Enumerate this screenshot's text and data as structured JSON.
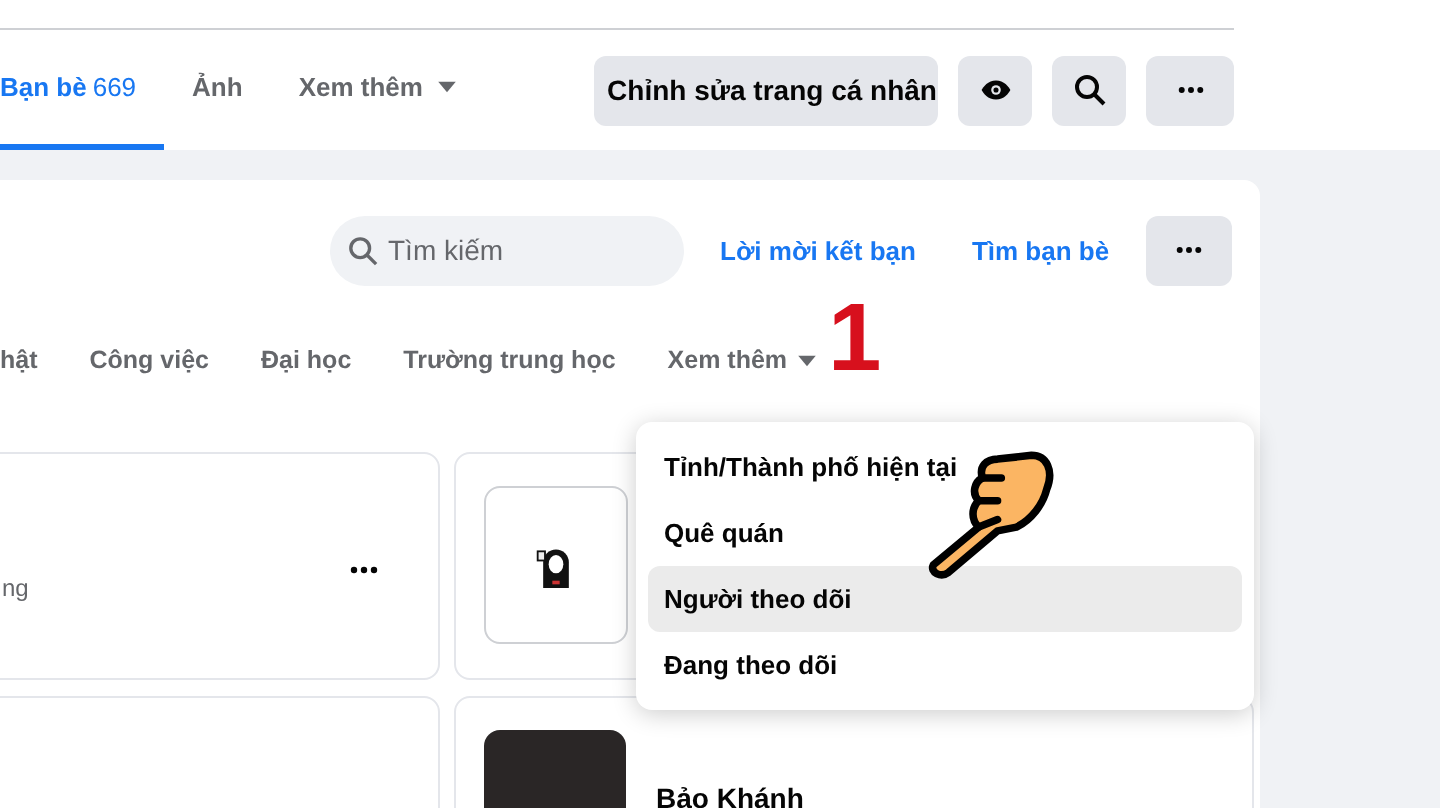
{
  "profile_tabs": [
    {
      "label": "Bạn bè",
      "count": "669",
      "selected": true,
      "dropdown": false
    },
    {
      "label": "Ảnh",
      "selected": false,
      "dropdown": false
    },
    {
      "label": "Xem thêm",
      "selected": false,
      "dropdown": true
    }
  ],
  "profile_actions": {
    "edit_button": "Chỉnh sửa trang cá nhân"
  },
  "friends": {
    "search": {
      "placeholder": "Tìm kiếm"
    },
    "links": [
      "Lời mời kết bạn",
      "Tìm bạn bè"
    ],
    "filters": [
      {
        "label": "hật",
        "selected": false,
        "dropdown": false
      },
      {
        "label": "Công việc",
        "selected": false,
        "dropdown": false
      },
      {
        "label": "Đại học",
        "selected": false,
        "dropdown": false
      },
      {
        "label": "Trường trung học",
        "selected": false,
        "dropdown": false
      },
      {
        "label": "Xem thêm",
        "selected": false,
        "dropdown": true
      }
    ],
    "cards": [
      {
        "kind": "partial",
        "subtitle": "ng"
      },
      {
        "kind": "sticker"
      },
      {
        "kind": "blank"
      },
      {
        "kind": "photo",
        "name": "Bảo Khánh"
      }
    ]
  },
  "annotation": {
    "step": "1"
  },
  "dropdown_menu": {
    "items": [
      {
        "label": "Tỉnh/Thành phố hiện tại",
        "selected": false
      },
      {
        "label": "Quê quán",
        "selected": false
      },
      {
        "label": "Người theo dõi",
        "selected": true
      },
      {
        "label": "Đang theo dõi",
        "selected": false
      }
    ]
  }
}
